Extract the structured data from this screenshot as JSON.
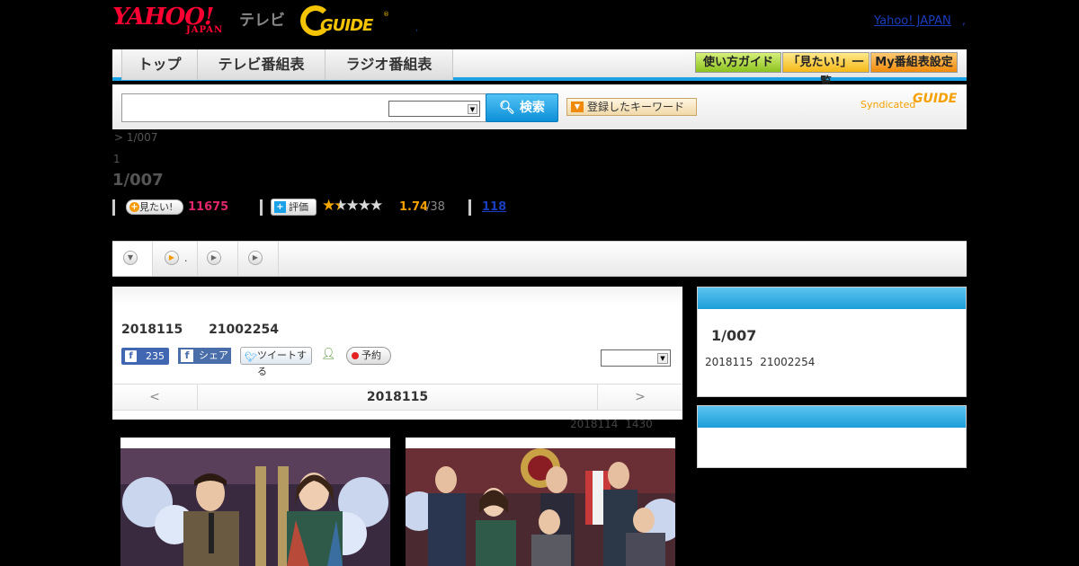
{
  "header": {
    "yahoo_logo": "YAHOO!",
    "yahoo_japan": "JAPAN",
    "tv_label": "テレビ",
    "gguide_logo": "GUIDE",
    "gguide_reg": "®",
    "dot": ",",
    "yahoo_japan_link": "Yahoo! JAPAN",
    "link_dot": ","
  },
  "nav": {
    "tabs": [
      {
        "label": "トップ"
      },
      {
        "label": "テレビ番組表"
      },
      {
        "label": "ラジオ番組表"
      }
    ],
    "buttons": [
      {
        "label": "使い方ガイド"
      },
      {
        "label": "「見たい!」一覧"
      },
      {
        "label": "My番組表設定"
      }
    ]
  },
  "search": {
    "input_value": "",
    "select_value": "",
    "button_label": "検索",
    "keyword_button_label": "登録したキーワード",
    "syndicated_label": "Syndicated",
    "syndicated_logo": "GUIDE"
  },
  "breadcrumb": "> 1/007",
  "subtitle_line": "1",
  "program_title": "1/007",
  "stats": {
    "want_label": "見たい!",
    "want_count": "11675",
    "rate_label": "評価",
    "rating_value": "1.74",
    "rating_count": "/38",
    "rating_fraction": 0.348,
    "review_count": "118"
  },
  "tabs": [
    {
      "icon": "chevron-down-icon",
      "label": ""
    },
    {
      "icon": "play-icon",
      "label": "."
    },
    {
      "icon": "play-icon",
      "label": ""
    },
    {
      "icon": "play-icon",
      "label": ""
    }
  ],
  "broadcast": {
    "date_line": "2018115 21002254",
    "fb_like_count": "235",
    "fb_share_label": "シェア",
    "tweet_label": "ツイートする",
    "reserve_label": "予約",
    "select_value": "",
    "prev_label": "<",
    "next_label": ">",
    "nav_date": "2018115",
    "updated": "2018114 1430"
  },
  "right_panel": {
    "title": "1/007",
    "sub": "2018115 21002254"
  },
  "colors": {
    "accent_blue": "#1aa1e6",
    "want_pink": "#e0266a",
    "rating_orange": "#f5a000"
  }
}
